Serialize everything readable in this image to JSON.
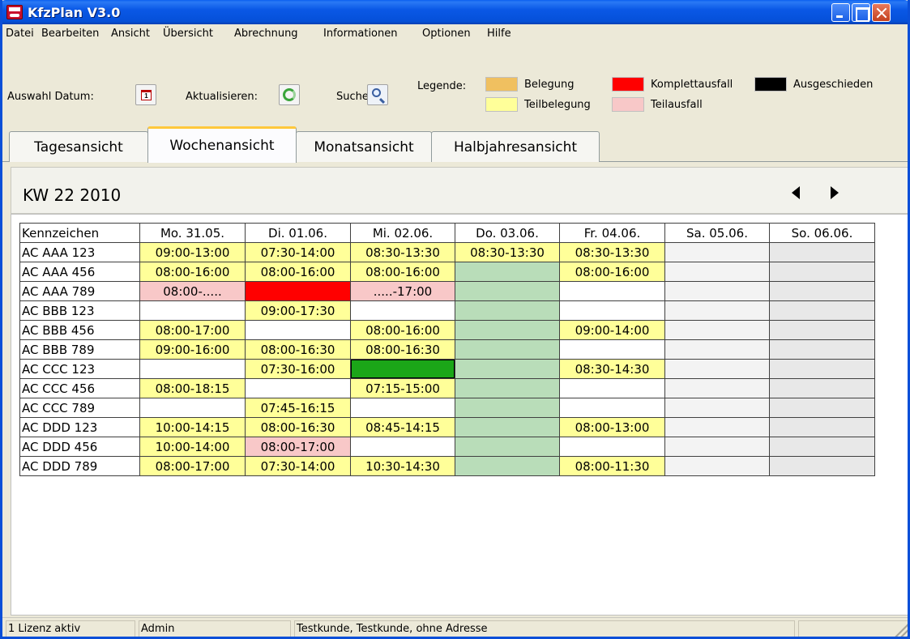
{
  "window": {
    "title": "KfzPlan V3.0"
  },
  "menu": [
    "Datei",
    "Bearbeiten",
    "Ansicht",
    "Übersicht",
    "Abrechnung",
    "Informationen",
    "Optionen",
    "Hilfe"
  ],
  "toolbar": {
    "date_label": "Auswahl Datum:",
    "refresh_label": "Aktualisieren:",
    "search_label": "Suche:",
    "legend_label": "Legende:",
    "legend": [
      {
        "label": "Belegung",
        "color": "#f0c060"
      },
      {
        "label": "Teilbelegung",
        "color": "#ffff99"
      },
      {
        "label": "Komplettausfall",
        "color": "#ff0000"
      },
      {
        "label": "Teilausfall",
        "color": "#f8c8c8"
      },
      {
        "label": "Ausgeschieden",
        "color": "#000000"
      }
    ]
  },
  "tabs": [
    {
      "label": "Tagesansicht",
      "active": false
    },
    {
      "label": "Wochenansicht",
      "active": true
    },
    {
      "label": "Monatsansicht",
      "active": false
    },
    {
      "label": "Halbjahresansicht",
      "active": false
    }
  ],
  "week": {
    "title": "KW 22 2010"
  },
  "grid": {
    "header": [
      "Kennzeichen",
      "Mo. 31.05.",
      "Di. 01.06.",
      "Mi. 02.06.",
      "Do. 03.06.",
      "Fr. 04.06.",
      "Sa. 05.06.",
      "So. 06.06."
    ],
    "rows": [
      {
        "plate": "AC AAA 123",
        "cells": [
          [
            "y",
            "09:00-13:00"
          ],
          [
            "y",
            "07:30-14:00"
          ],
          [
            "y",
            "08:30-13:30"
          ],
          [
            "y",
            "08:30-13:30"
          ],
          [
            "y",
            "08:30-13:30"
          ],
          [
            "sa",
            ""
          ],
          [
            "so",
            ""
          ]
        ]
      },
      {
        "plate": "AC AAA 456",
        "cells": [
          [
            "y",
            "08:00-16:00"
          ],
          [
            "y",
            "08:00-16:00"
          ],
          [
            "y",
            "08:00-16:00"
          ],
          [
            "g",
            ""
          ],
          [
            "y",
            "08:00-16:00"
          ],
          [
            "sa",
            ""
          ],
          [
            "so",
            ""
          ]
        ]
      },
      {
        "plate": "AC AAA 789",
        "cells": [
          [
            "p",
            "08:00-....."
          ],
          [
            "r",
            ""
          ],
          [
            "p",
            ".....-17:00"
          ],
          [
            "g",
            ""
          ],
          [
            "w",
            ""
          ],
          [
            "sa",
            ""
          ],
          [
            "so",
            ""
          ]
        ]
      },
      {
        "plate": "AC BBB 123",
        "cells": [
          [
            "w",
            ""
          ],
          [
            "y",
            "09:00-17:30"
          ],
          [
            "w",
            ""
          ],
          [
            "g",
            ""
          ],
          [
            "w",
            ""
          ],
          [
            "sa",
            ""
          ],
          [
            "so",
            ""
          ]
        ]
      },
      {
        "plate": "AC BBB 456",
        "cells": [
          [
            "y",
            "08:00-17:00"
          ],
          [
            "w",
            ""
          ],
          [
            "y",
            "08:00-16:00"
          ],
          [
            "g",
            ""
          ],
          [
            "y",
            "09:00-14:00"
          ],
          [
            "sa",
            ""
          ],
          [
            "so",
            ""
          ]
        ]
      },
      {
        "plate": "AC BBB 789",
        "cells": [
          [
            "y",
            "09:00-16:00"
          ],
          [
            "y",
            "08:00-16:30"
          ],
          [
            "y",
            "08:00-16:30"
          ],
          [
            "g",
            ""
          ],
          [
            "w",
            ""
          ],
          [
            "sa",
            ""
          ],
          [
            "so",
            ""
          ]
        ]
      },
      {
        "plate": "AC CCC 123",
        "cells": [
          [
            "w",
            ""
          ],
          [
            "y",
            "07:30-16:00"
          ],
          [
            "sel",
            ""
          ],
          [
            "g",
            ""
          ],
          [
            "y",
            "08:30-14:30"
          ],
          [
            "sa",
            ""
          ],
          [
            "so",
            ""
          ]
        ]
      },
      {
        "plate": "AC CCC 456",
        "cells": [
          [
            "y",
            "08:00-18:15"
          ],
          [
            "w",
            ""
          ],
          [
            "y",
            "07:15-15:00"
          ],
          [
            "g",
            ""
          ],
          [
            "w",
            ""
          ],
          [
            "sa",
            ""
          ],
          [
            "so",
            ""
          ]
        ]
      },
      {
        "plate": "AC CCC 789",
        "cells": [
          [
            "w",
            ""
          ],
          [
            "y",
            "07:45-16:15"
          ],
          [
            "w",
            ""
          ],
          [
            "g",
            ""
          ],
          [
            "w",
            ""
          ],
          [
            "sa",
            ""
          ],
          [
            "so",
            ""
          ]
        ]
      },
      {
        "plate": "AC DDD 123",
        "cells": [
          [
            "y",
            "10:00-14:15"
          ],
          [
            "y",
            "08:00-16:30"
          ],
          [
            "y",
            "08:45-14:15"
          ],
          [
            "g",
            ""
          ],
          [
            "y",
            "08:00-13:00"
          ],
          [
            "sa",
            ""
          ],
          [
            "so",
            ""
          ]
        ]
      },
      {
        "plate": "AC DDD 456",
        "cells": [
          [
            "y",
            "10:00-14:00"
          ],
          [
            "p",
            "08:00-17:00"
          ],
          [
            "w",
            ""
          ],
          [
            "g",
            ""
          ],
          [
            "w",
            ""
          ],
          [
            "sa",
            ""
          ],
          [
            "so",
            ""
          ]
        ]
      },
      {
        "plate": "AC DDD 789",
        "cells": [
          [
            "y",
            "08:00-17:00"
          ],
          [
            "y",
            "07:30-14:00"
          ],
          [
            "y",
            "10:30-14:30"
          ],
          [
            "g",
            ""
          ],
          [
            "y",
            "08:00-11:30"
          ],
          [
            "sa",
            ""
          ],
          [
            "so",
            ""
          ]
        ]
      }
    ]
  },
  "status": {
    "license": "1 Lizenz aktiv",
    "user": "Admin",
    "customer": "Testkunde, Testkunde, ohne Adresse"
  }
}
